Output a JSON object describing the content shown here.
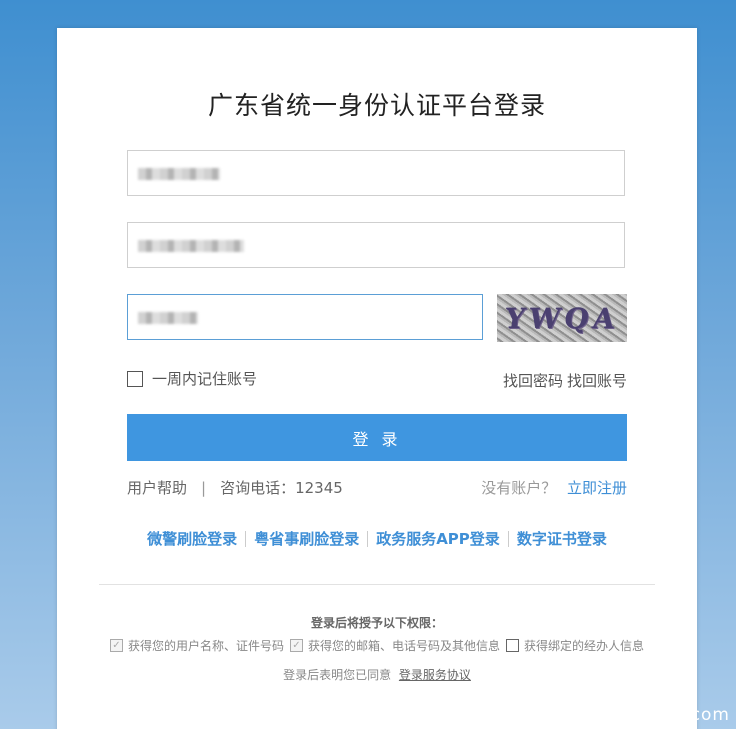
{
  "title": "广东省统一身份认证平台登录",
  "form": {
    "username_value": "",
    "idnumber_value": "",
    "password_value": "",
    "captcha_text": "YWQA"
  },
  "remember_label": "一周内记住账号",
  "forgot_password": "找回密码",
  "forgot_account": "找回账号",
  "login_button": "登 录",
  "help": {
    "user_help": "用户帮助",
    "separator": "|",
    "hotline": "咨询电话：12345"
  },
  "register": {
    "prompt": "没有账户？",
    "link": "立即注册"
  },
  "alt_logins": [
    "微警刷脸登录",
    "粤省事刷脸登录",
    "政务服务APP登录",
    "数字证书登录"
  ],
  "permissions": {
    "title": "登录后将授予以下权限：",
    "items": [
      {
        "label": "获得您的用户名称、证件号码",
        "checked": true
      },
      {
        "label": "获得您的邮箱、电话号码及其他信息",
        "checked": true
      },
      {
        "label": "获得绑定的经办人信息",
        "checked": false
      }
    ]
  },
  "agreement": {
    "text": "登录后表明您已同意",
    "link": "登录服务协议"
  },
  "watermark": "com",
  "colors": {
    "primary": "#3f96e0",
    "link": "#3f8fd6"
  }
}
